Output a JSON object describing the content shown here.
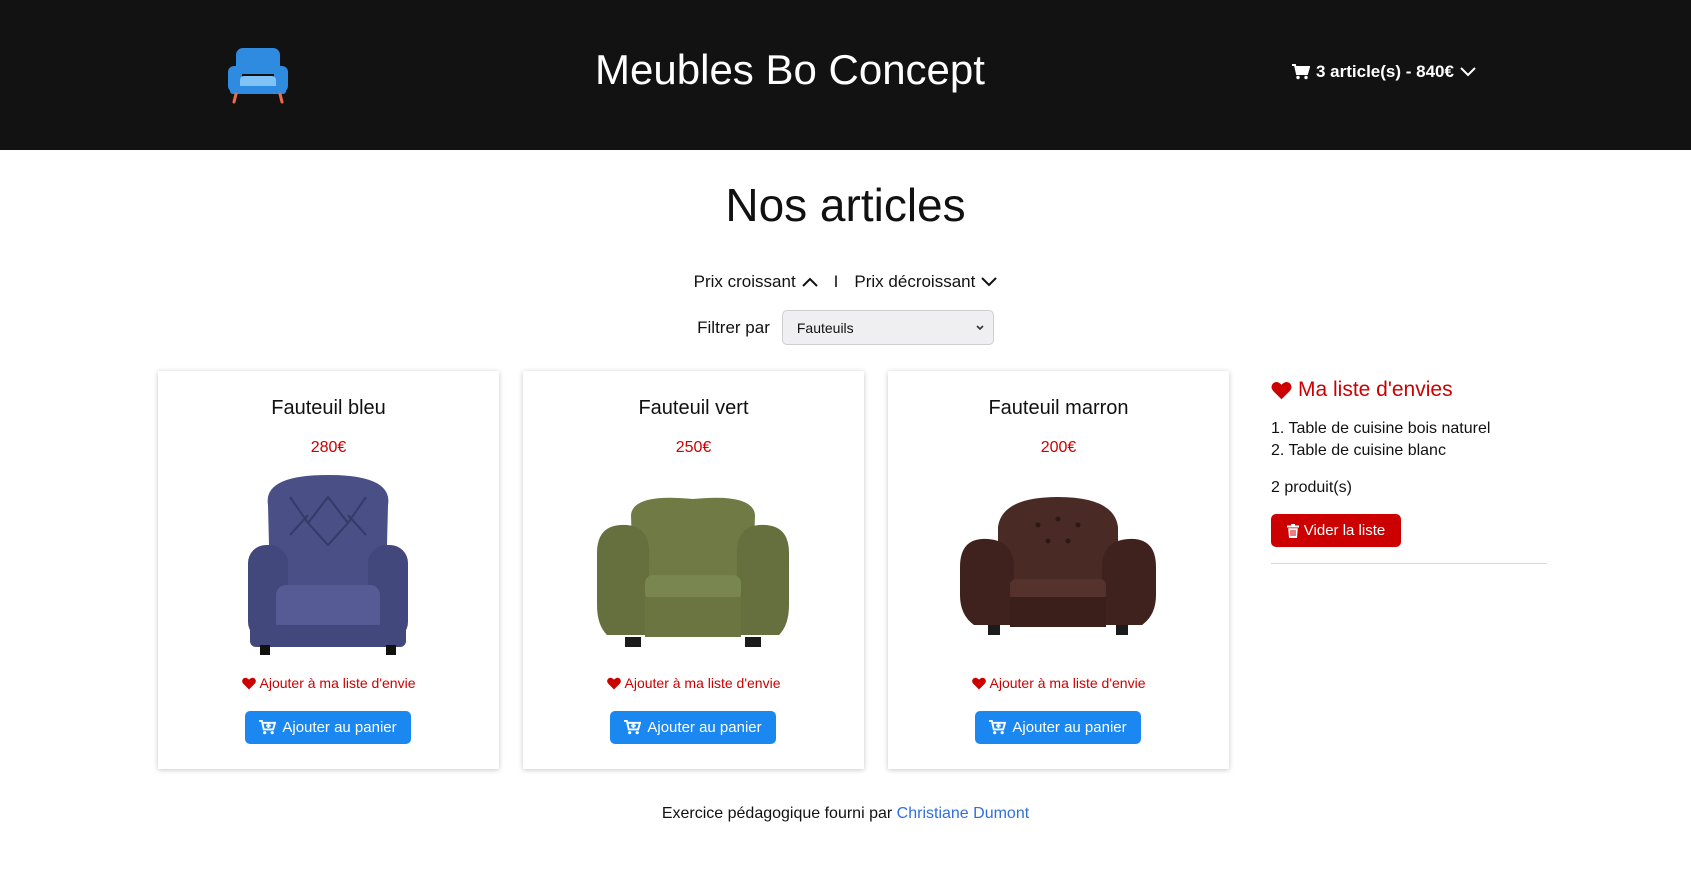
{
  "header": {
    "logo_icon": "armchair-icon",
    "title": "Meubles Bo Concept",
    "cart_icon": "cart-icon",
    "cart_summary": "3 article(s) - 840€"
  },
  "main": {
    "heading": "Nos articles",
    "sort": {
      "ascending_label": "Prix croissant",
      "separator": "I",
      "descending_label": "Prix décroissant"
    },
    "filter": {
      "label": "Filtrer par",
      "selected": "Fauteuils"
    },
    "products": [
      {
        "name": "Fauteuil bleu",
        "price": "280€",
        "color": "#4a4f86",
        "wish_label": "Ajouter à ma liste d'envie",
        "add_label": "Ajouter au panier"
      },
      {
        "name": "Fauteuil vert",
        "price": "250€",
        "color": "#6f7a45",
        "wish_label": "Ajouter à ma liste d'envie",
        "add_label": "Ajouter au panier"
      },
      {
        "name": "Fauteuil marron",
        "price": "200€",
        "color": "#4a2a24",
        "wish_label": "Ajouter à ma liste d'envie",
        "add_label": "Ajouter au panier"
      }
    ]
  },
  "wishlist": {
    "title": "Ma liste d'envies",
    "items": [
      "1. Table de cuisine bois naturel",
      "2. Table de cuisine blanc"
    ],
    "count": "2 produit(s)",
    "clear_label": "Vider la liste"
  },
  "footer": {
    "text": "Exercice pédagogique fourni par",
    "author": "Christiane Dumont"
  },
  "colors": {
    "header_bg": "#121212",
    "accent_red": "#cc0000",
    "button_blue": "#1b87f0",
    "link_blue": "#2f6fe0"
  }
}
